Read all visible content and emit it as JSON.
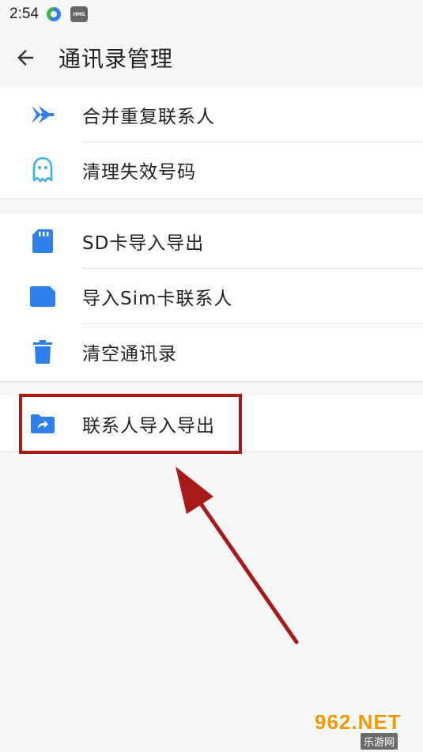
{
  "status_bar": {
    "time": "2:54",
    "icons": [
      "refresh-app-icon",
      "hms-icon"
    ],
    "hms_text": "HMS"
  },
  "appbar": {
    "back_icon": "arrow-left-icon",
    "title": "通讯录管理"
  },
  "groups": [
    {
      "items": [
        {
          "icon": "merge-arrows-icon",
          "label": "合并重复联系人"
        },
        {
          "icon": "ghost-icon",
          "label": "清理失效号码"
        }
      ]
    },
    {
      "items": [
        {
          "icon": "sd-card-icon",
          "label": "SD卡导入导出"
        },
        {
          "icon": "sim-card-icon",
          "label": "导入Sim卡联系人"
        },
        {
          "icon": "trash-icon",
          "label": "清空通讯录"
        }
      ]
    },
    {
      "items": [
        {
          "icon": "folder-share-icon",
          "label": "联系人导入导出"
        }
      ]
    }
  ],
  "annotation": {
    "highlight_color": "#a81a1a",
    "arrow_color": "#a81a1a"
  },
  "colors": {
    "accent_blue": "#2f80ed",
    "background": "#f7f7f7",
    "card": "#ffffff"
  },
  "watermark": {
    "top": "962.NET",
    "bottom": "乐游网"
  }
}
